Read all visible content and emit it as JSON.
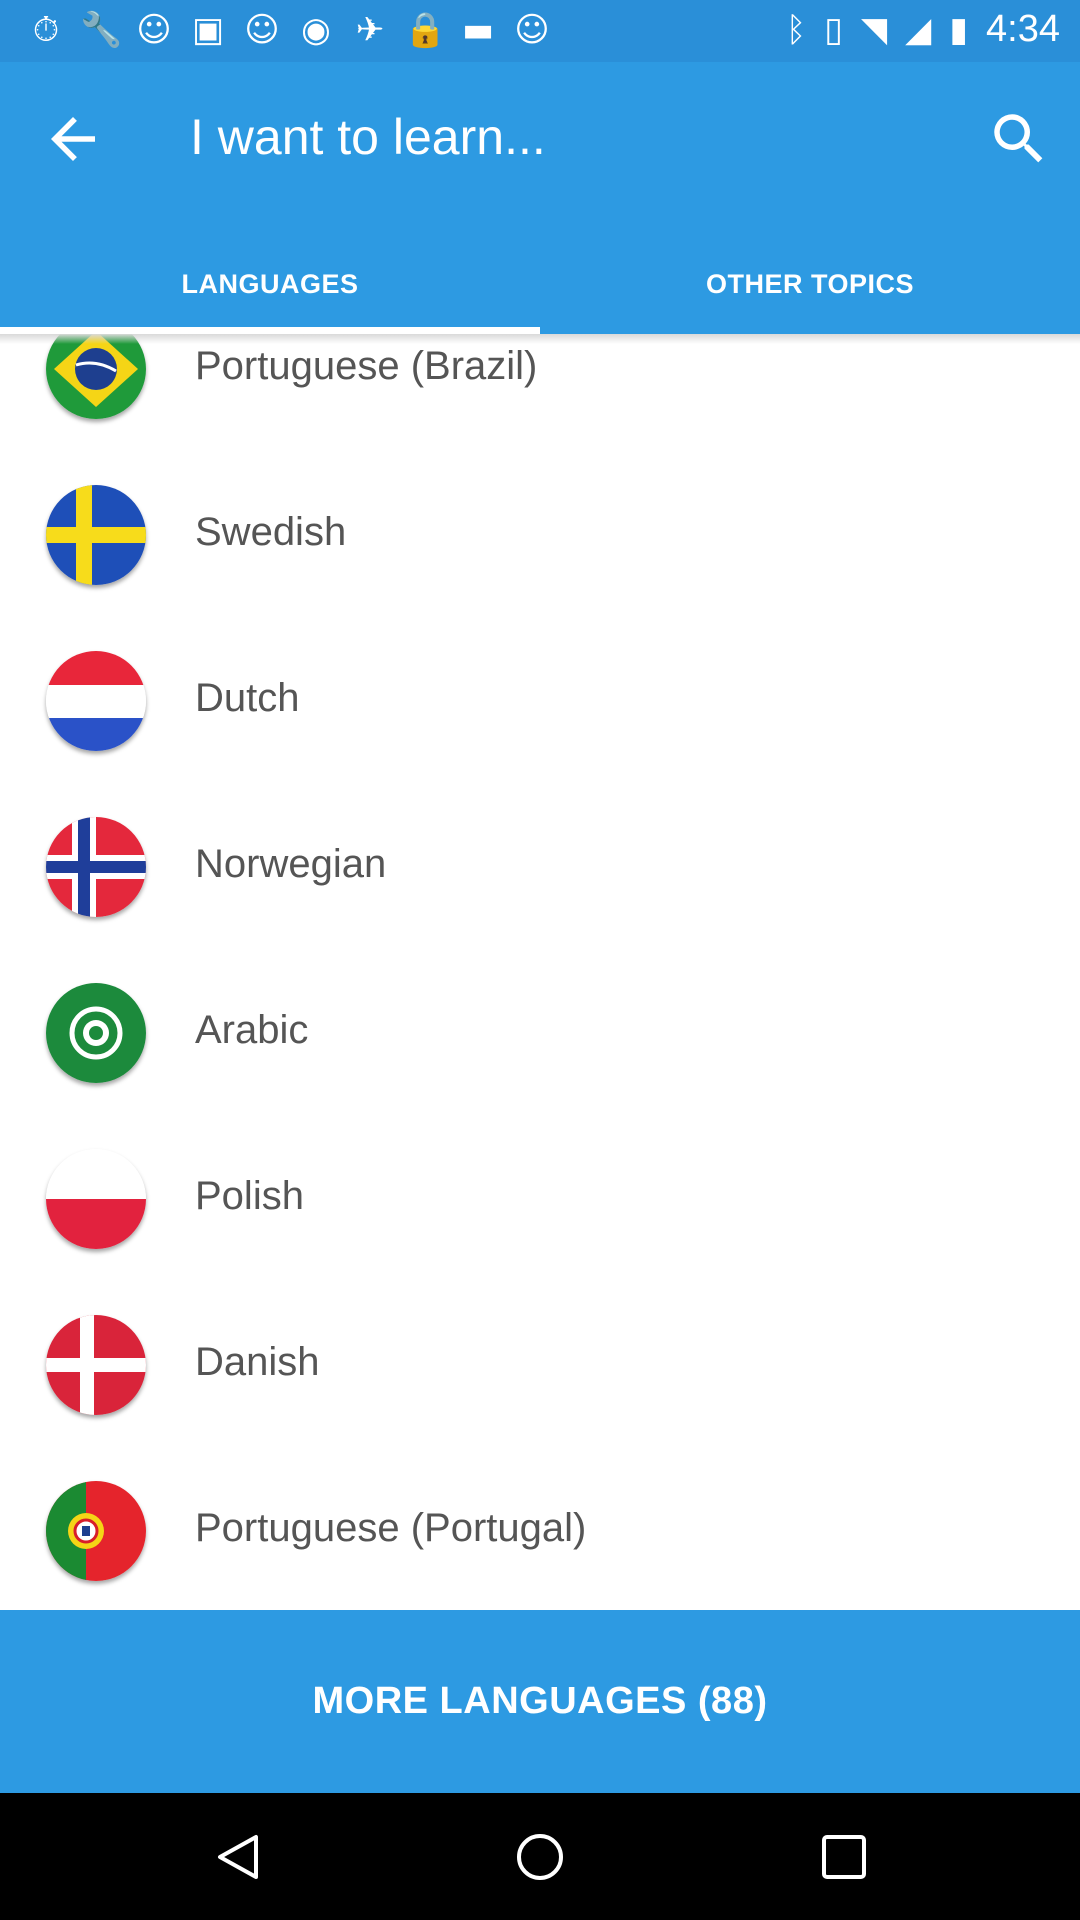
{
  "status_bar": {
    "time": "4:34",
    "left_icons": [
      "timer-icon",
      "wrench-icon",
      "smiley-icon",
      "flipboard-icon",
      "smiley-icon",
      "poll-icon",
      "fake-gps-icon",
      "lock-icon",
      "chat-icon",
      "smiley-icon"
    ],
    "right_icons": [
      "bluetooth-icon",
      "vibrate-icon",
      "wifi-icon",
      "signal-icon",
      "battery-icon"
    ]
  },
  "app_bar": {
    "title": "I want to learn...",
    "tabs": [
      {
        "label": "LANGUAGES",
        "active": true
      },
      {
        "label": "OTHER TOPICS",
        "active": false
      }
    ],
    "color": "#2d9ae2"
  },
  "languages": [
    {
      "name": "Portuguese (Brazil)",
      "flag": "brazil-flag-icon"
    },
    {
      "name": "Swedish",
      "flag": "sweden-flag-icon"
    },
    {
      "name": "Dutch",
      "flag": "netherlands-flag-icon"
    },
    {
      "name": "Norwegian",
      "flag": "norway-flag-icon"
    },
    {
      "name": "Arabic",
      "flag": "arab-league-flag-icon"
    },
    {
      "name": "Polish",
      "flag": "poland-flag-icon"
    },
    {
      "name": "Danish",
      "flag": "denmark-flag-icon"
    },
    {
      "name": "Portuguese (Portugal)",
      "flag": "portugal-flag-icon"
    }
  ],
  "more_button": {
    "label": "MORE LANGUAGES (88)"
  }
}
